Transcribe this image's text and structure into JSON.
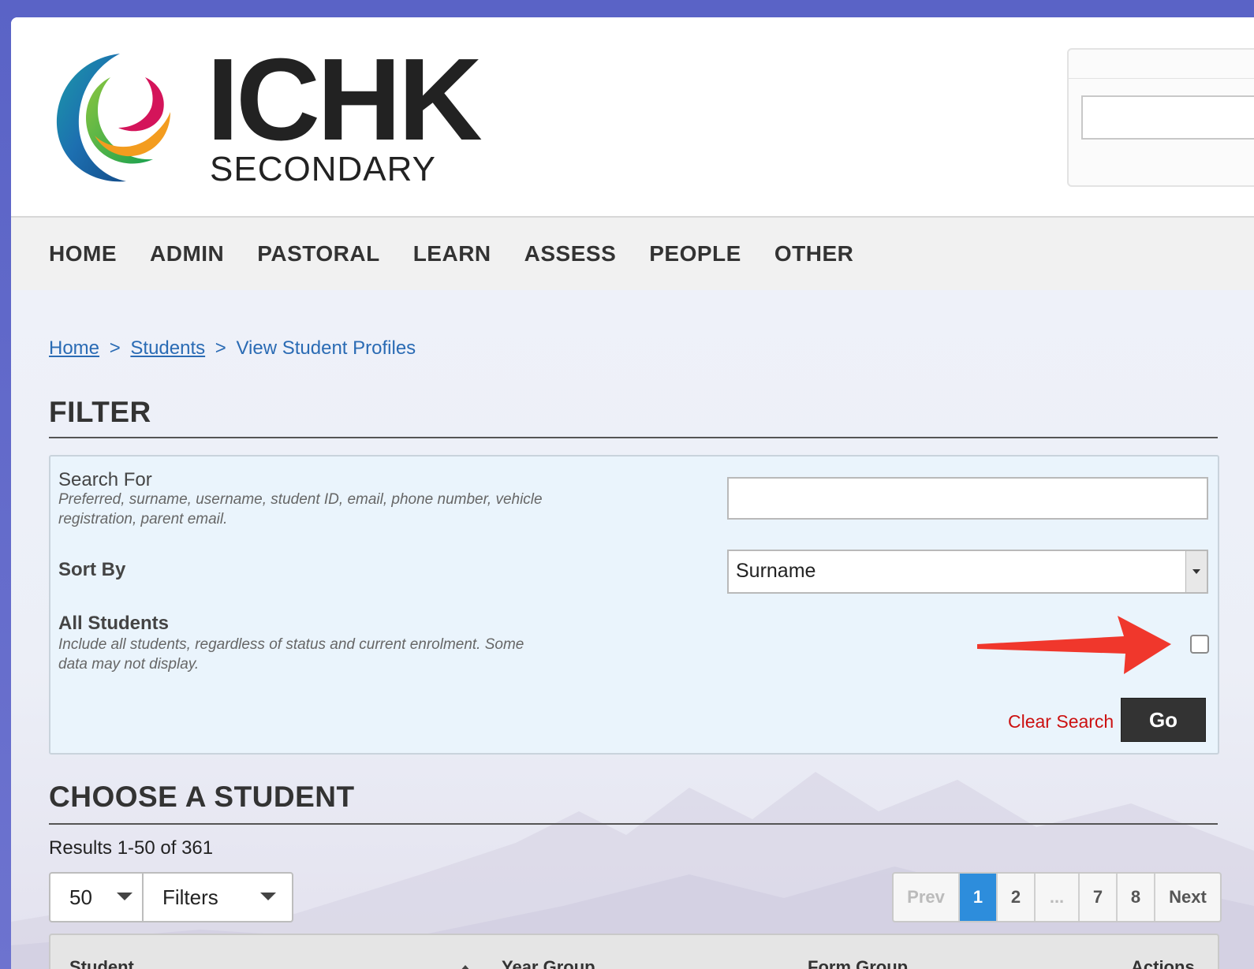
{
  "logo": {
    "title": "ICHK",
    "subtitle": "SECONDARY"
  },
  "nav": [
    "HOME",
    "ADMIN",
    "PASTORAL",
    "LEARN",
    "ASSESS",
    "PEOPLE",
    "OTHER"
  ],
  "breadcrumb": {
    "home": "Home",
    "sep": ">",
    "students": "Students",
    "current": "View Student Profiles"
  },
  "filter": {
    "heading": "FILTER",
    "search_label": "Search For",
    "search_desc": "Preferred, surname, username, student ID, email, phone number, vehicle registration, parent email.",
    "search_value": "",
    "sort_label": "Sort By",
    "sort_value": "Surname",
    "all_label": "All Students",
    "all_desc": "Include all students, regardless of status and current enrolment. Some data may not display.",
    "all_checked": false,
    "clear": "Clear Search",
    "go": "Go"
  },
  "choose": {
    "heading": "CHOOSE A STUDENT",
    "results": "Results 1-50 of 361",
    "per_page": "50",
    "filters": "Filters",
    "pager": {
      "prev": "Prev",
      "pages": [
        "1",
        "2",
        "...",
        "7",
        "8"
      ],
      "next": "Next",
      "active": "1"
    },
    "columns": [
      "Student",
      "Year Group",
      "Form Group",
      "Actions"
    ]
  },
  "colors": {
    "accent": "#2d8ddc",
    "link": "#2a6bb4",
    "clear": "#cc1111",
    "button": "#333333"
  }
}
